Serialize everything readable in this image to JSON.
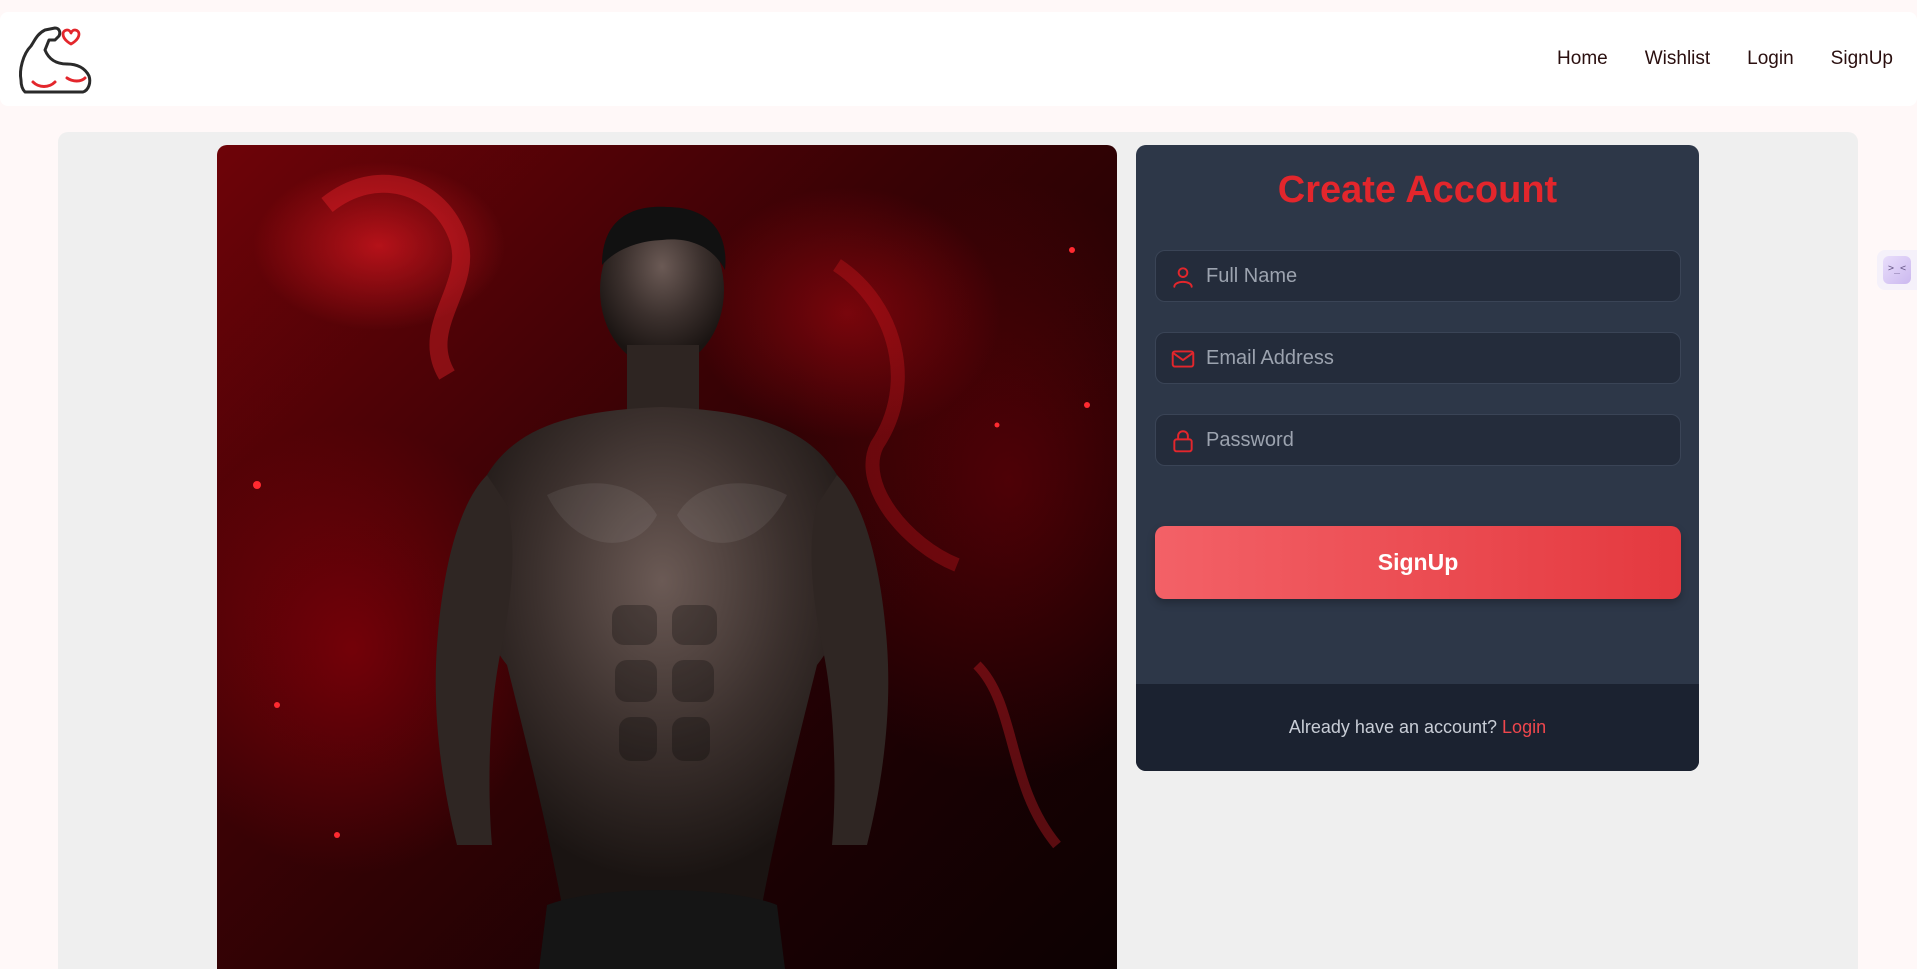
{
  "header": {
    "logo_icon": "flexed-arm-heart-icon",
    "nav": [
      {
        "label": "Home"
      },
      {
        "label": "Wishlist"
      },
      {
        "label": "Login"
      },
      {
        "label": "SignUp"
      }
    ]
  },
  "hero": {
    "image": "muscular-man-red-smoke-photo"
  },
  "form": {
    "title": "Create Account",
    "fields": [
      {
        "icon": "user-icon",
        "placeholder": "Full Name",
        "value": ""
      },
      {
        "icon": "envelope-icon",
        "placeholder": "Email Address",
        "value": ""
      },
      {
        "icon": "lock-icon",
        "placeholder": "Password",
        "value": ""
      }
    ],
    "submit_label": "SignUp",
    "footer_text": "Already have an account?",
    "footer_link": "Login"
  },
  "colors": {
    "accent": "#e3262c",
    "card_bg": "#2d3748",
    "button_start": "#f36167",
    "button_end": "#e4393f"
  },
  "side_widget": {
    "icon": "assistant-face-icon",
    "glyph": ">_<"
  }
}
